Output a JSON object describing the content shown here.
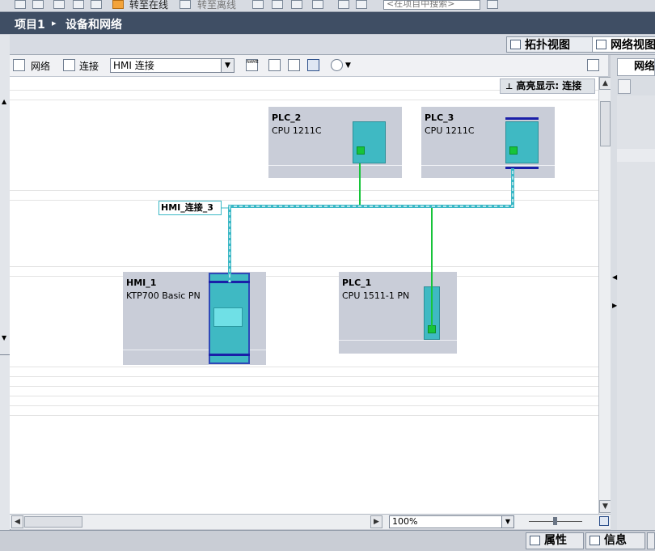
{
  "top_toolbar": {
    "go_online": "转至在线",
    "go_offline": "转至离线",
    "search_placeholder": "<在项目中搜索>"
  },
  "breadcrumb": {
    "project": "项目1",
    "separator": "▸",
    "section": "设备和网络"
  },
  "view_tabs": {
    "topology": "拓扑视图",
    "network": "网络视图"
  },
  "editor_toolbar": {
    "network_label": "网络",
    "connections_label": "连接",
    "connection_type": "HMI 连接",
    "name_icon_text": "NAME"
  },
  "canvas": {
    "highlight_label": "高亮显示: 连接",
    "connection_label": "HMI_连接_3",
    "devices": [
      {
        "name": "PLC_2",
        "type": "CPU 1211C"
      },
      {
        "name": "PLC_3",
        "type": "CPU 1211C"
      },
      {
        "name": "HMI_1",
        "type": "KTP700 Basic PN"
      },
      {
        "name": "PLC_1",
        "type": "CPU 1511-1 PN"
      }
    ]
  },
  "bottom_bar": {
    "zoom": "100%"
  },
  "right_panel": {
    "tab": "网络"
  },
  "status_bar": {
    "properties": "属性",
    "info": "信息"
  },
  "colors": {
    "header": "#3f4e64",
    "device_bg": "#c9cdd8",
    "module": "#3fb9c3",
    "port": "#17c43a",
    "hmi_connection": "#3bb8c6"
  }
}
